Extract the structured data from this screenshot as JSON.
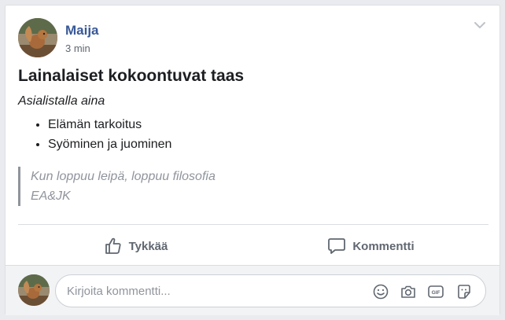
{
  "post": {
    "author": "Maija",
    "time": "3 min",
    "title": "Lainalaiset kokoontuvat taas",
    "subtitle": "Asialistalla aina",
    "list_items": [
      "Elämän tarkoitus",
      "Syöminen ja juominen"
    ],
    "quote_lines": [
      "Kun loppuu leipä, loppuu filosofia",
      "EA&JK"
    ]
  },
  "actions": {
    "like_label": "Tykkää",
    "comment_label": "Kommentti"
  },
  "comment_box": {
    "placeholder": "Kirjoita kommentti..."
  },
  "icons": {
    "chevron": "chevron-down-icon",
    "like": "thumbs-up-icon",
    "comment": "speech-bubble-icon",
    "emoji": "smiley-icon",
    "camera": "camera-icon",
    "gif": "gif-icon",
    "sticker": "sticker-icon"
  },
  "colors": {
    "author": "#385898",
    "muted": "#616770",
    "quote": "#90949c",
    "icon": "#606770"
  }
}
